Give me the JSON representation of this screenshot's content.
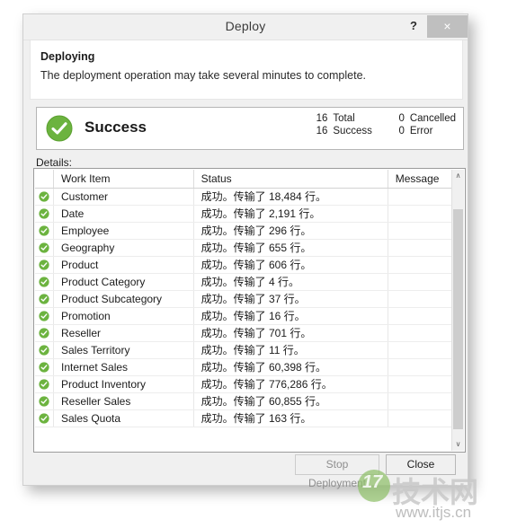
{
  "window": {
    "title": "Deploy",
    "help_label": "?",
    "close_label": "×"
  },
  "instruction": {
    "heading": "Deploying",
    "body": "The deployment operation may take several minutes to complete."
  },
  "summary": {
    "status_label": "Success",
    "icon": "success-check-icon",
    "counters": {
      "total_value": "16",
      "total_label": "Total",
      "cancelled_value": "0",
      "cancelled_label": "Cancelled",
      "success_value": "16",
      "success_label": "Success",
      "error_value": "0",
      "error_label": "Error"
    }
  },
  "details": {
    "label": "Details:",
    "columns": [
      "",
      "Work Item",
      "Status",
      "Message"
    ],
    "rows": [
      {
        "icon": "success-check-icon",
        "work_item": "Customer",
        "status": "成功。传输了 18,484 行。",
        "message": ""
      },
      {
        "icon": "success-check-icon",
        "work_item": "Date",
        "status": "成功。传输了 2,191 行。",
        "message": ""
      },
      {
        "icon": "success-check-icon",
        "work_item": "Employee",
        "status": "成功。传输了 296 行。",
        "message": ""
      },
      {
        "icon": "success-check-icon",
        "work_item": "Geography",
        "status": "成功。传输了 655 行。",
        "message": ""
      },
      {
        "icon": "success-check-icon",
        "work_item": "Product",
        "status": "成功。传输了 606 行。",
        "message": ""
      },
      {
        "icon": "success-check-icon",
        "work_item": "Product Category",
        "status": "成功。传输了 4 行。",
        "message": ""
      },
      {
        "icon": "success-check-icon",
        "work_item": "Product Subcategory",
        "status": "成功。传输了 37 行。",
        "message": ""
      },
      {
        "icon": "success-check-icon",
        "work_item": "Promotion",
        "status": "成功。传输了 16 行。",
        "message": ""
      },
      {
        "icon": "success-check-icon",
        "work_item": "Reseller",
        "status": "成功。传输了 701 行。",
        "message": ""
      },
      {
        "icon": "success-check-icon",
        "work_item": "Sales Territory",
        "status": "成功。传输了 11 行。",
        "message": ""
      },
      {
        "icon": "success-check-icon",
        "work_item": "Internet Sales",
        "status": "成功。传输了 60,398 行。",
        "message": ""
      },
      {
        "icon": "success-check-icon",
        "work_item": "Product Inventory",
        "status": "成功。传输了 776,286 行。",
        "message": ""
      },
      {
        "icon": "success-check-icon",
        "work_item": "Reseller Sales",
        "status": "成功。传输了 60,855 行。",
        "message": ""
      },
      {
        "icon": "success-check-icon",
        "work_item": "Sales Quota",
        "status": "成功。传输了 163 行。",
        "message": ""
      }
    ]
  },
  "scrollbar": {
    "up_glyph": "∧",
    "down_glyph": "∨"
  },
  "footer": {
    "stop_label": "Stop Deployment",
    "close_label": "Close"
  },
  "watermark": {
    "mark": "17",
    "name": "技术网",
    "url": "www.itjs.cn"
  },
  "colors": {
    "success_green": "#6cb33f",
    "dialog_bg": "#f0f0f0",
    "panel_white": "#ffffff",
    "close_button_bg": "#bfbfbf",
    "scroll_thumb": "#cdcdcd"
  }
}
